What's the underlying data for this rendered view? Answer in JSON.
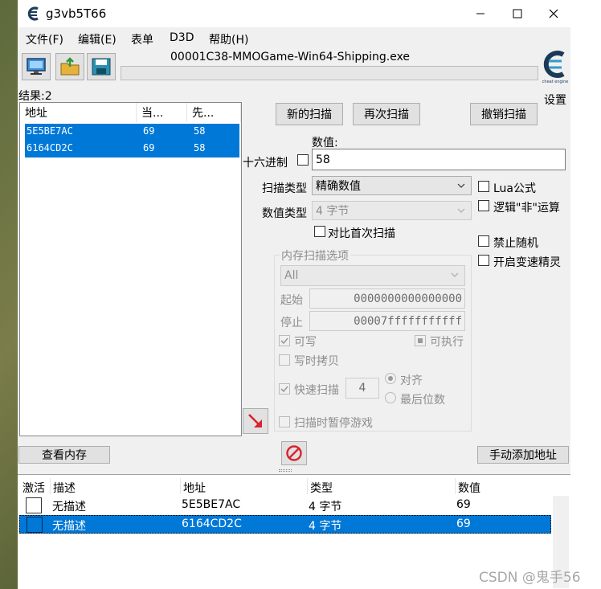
{
  "window": {
    "title": "g3vb5T66",
    "process_name": "00001C38-MMOGame-Win64-Shipping.exe",
    "settings_label": "设置"
  },
  "menu": [
    "文件(F)",
    "编辑(E)",
    "表单",
    "D3D",
    "帮助(H)"
  ],
  "results": {
    "label": "结果:2",
    "columns": [
      "地址",
      "当...",
      "先..."
    ],
    "rows": [
      {
        "address": "5E5BE7AC",
        "current": "69",
        "previous": "58"
      },
      {
        "address": "6164CD2C",
        "current": "69",
        "previous": "58"
      }
    ]
  },
  "scan": {
    "new_scan": "新的扫描",
    "next_scan": "再次扫描",
    "undo_scan": "撤销扫描",
    "value_label": "数值:",
    "hex_label": "十六进制",
    "value": "58",
    "scan_type_label": "扫描类型",
    "scan_type_value": "精确数值",
    "value_type_label": "数值类型",
    "value_type_value": "4 字节",
    "compare_first": "对比首次扫描",
    "lua_formula": "Lua公式",
    "logical_not": "逻辑\"非\"运算",
    "disable_random": "禁止随机",
    "speedhack": "开启变速精灵"
  },
  "memory_options": {
    "title": "内存扫描选项",
    "region": "All",
    "start_label": "起始",
    "start_value": "0000000000000000",
    "stop_label": "停止",
    "stop_value": "00007fffffffffff",
    "writable": "可写",
    "executable": "可执行",
    "copy_on_write": "写时拷贝",
    "fast_scan": "快速扫描",
    "fast_scan_value": "4",
    "align": "对齐",
    "last_digits": "最后位数",
    "pause_game": "扫描时暂停游戏"
  },
  "buttons": {
    "view_memory": "查看内存",
    "add_manually": "手动添加地址"
  },
  "address_table": {
    "columns": [
      "激活",
      "描述",
      "地址",
      "类型",
      "数值"
    ],
    "rows": [
      {
        "description": "无描述",
        "address": "5E5BE7AC",
        "type": "4 字节",
        "value": "69"
      },
      {
        "description": "无描述",
        "address": "6164CD2C",
        "type": "4 字节",
        "value": "69"
      }
    ]
  },
  "watermark": "CSDN @鬼手56",
  "colors": {
    "selection": "#0078d7",
    "accent_red": "#d9232e"
  }
}
